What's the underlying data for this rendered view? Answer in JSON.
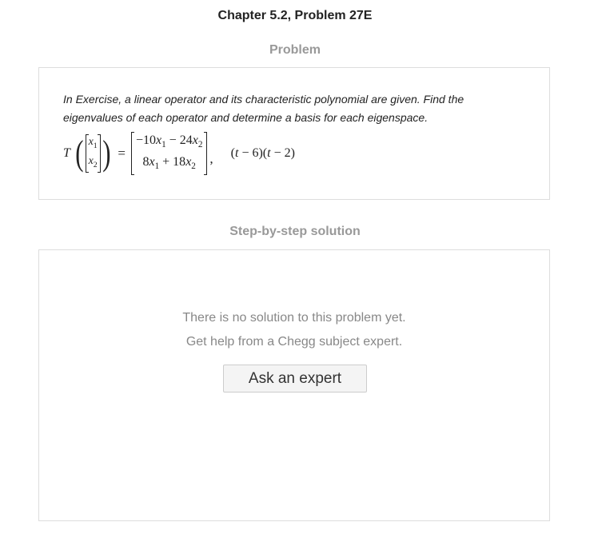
{
  "header": {
    "title": "Chapter 5.2, Problem 27E"
  },
  "problem": {
    "label": "Problem",
    "text_line1": "In Exercise, a linear operator and its characteristic polynomial are given. Find the",
    "text_line2": "eigenvalues of each operator and determine a basis for each eigenspace.",
    "equation": {
      "operator": "T",
      "input_row1_var": "x",
      "input_row1_sub": "1",
      "input_row2_var": "x",
      "input_row2_sub": "2",
      "equals": "=",
      "output_row1_a": "−10",
      "output_row1_var1": "x",
      "output_row1_sub1": "1",
      "output_row1_op": " − 24",
      "output_row1_var2": "x",
      "output_row1_sub2": "2",
      "output_row2_a": "8",
      "output_row2_var1": "x",
      "output_row2_sub1": "1",
      "output_row2_op": " + 18",
      "output_row2_var2": "x",
      "output_row2_sub2": "2",
      "comma": ",",
      "poly_p1": "(",
      "poly_t1": "t",
      "poly_m1": " − 6)(",
      "poly_t2": "t",
      "poly_m2": " − 2)"
    }
  },
  "solution": {
    "label": "Step-by-step solution",
    "no_solution_text": "There is no solution to this problem yet.",
    "help_text": "Get help from a Chegg subject expert.",
    "button_label": "Ask an expert"
  }
}
